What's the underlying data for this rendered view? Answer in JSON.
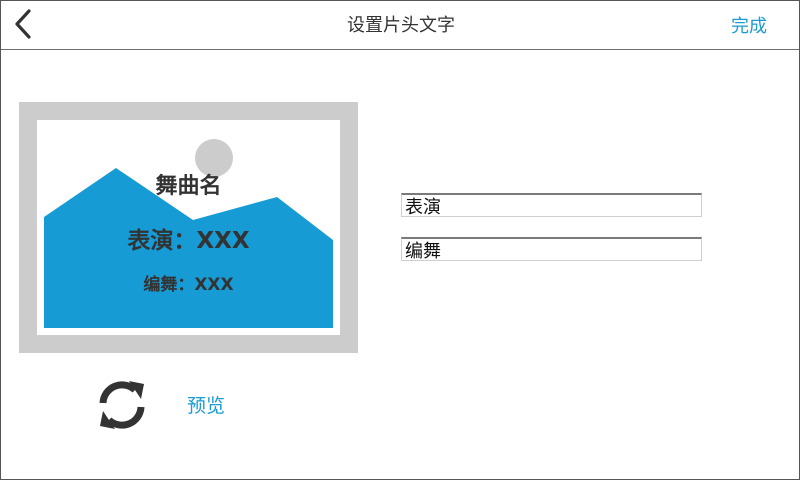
{
  "header": {
    "title": "设置片头文字",
    "done_label": "完成",
    "back_icon": "chevron-left-icon"
  },
  "preview_card": {
    "song_title": "舞曲名",
    "performance_line": "表演：XXX",
    "choreography_line": "编舞：XXX",
    "image_placeholder_icon": "image-placeholder-icon"
  },
  "form": {
    "performance_value": "表演",
    "choreography_value": "编舞"
  },
  "actions": {
    "refresh_icon": "refresh-icon",
    "preview_label": "预览"
  },
  "colors": {
    "accent": "#1a9bd4",
    "mountain": "#169bd5",
    "placeholder_gray": "#cccccc",
    "text": "#333333"
  }
}
